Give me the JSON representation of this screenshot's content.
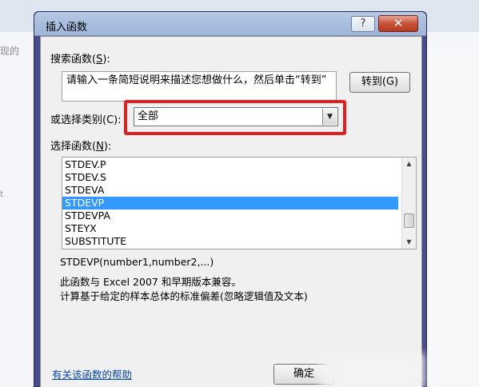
{
  "background": {
    "left_text": "现的",
    "side_text": "t"
  },
  "dialog": {
    "title": "插入函数",
    "help_button": "?",
    "close_button": "✕",
    "search_label": "搜索函数(",
    "search_label_key": "S",
    "search_label_end": "):",
    "search_text": "请输入一条简短说明来描述您想做什么，然后单击“转到”",
    "go_button": "转到(G)",
    "category_label": "或选择类别(C):",
    "category_value": "全部",
    "function_label": "选择函数(",
    "function_label_key": "N",
    "function_label_end": "):",
    "functions": [
      "STDEV.P",
      "STDEV.S",
      "STDEVA",
      "STDEVP",
      "STDEVPA",
      "STEYX",
      "SUBSTITUTE"
    ],
    "selected_function": "STDEVP",
    "signature": "STDEVP(number1,number2,...)",
    "description_line1": "此函数与 Excel 2007 和早期版本兼容。",
    "description_line2": "计算基于给定的样本总体的标准偏差(忽略逻辑值及文本)",
    "help_link": "有关该函数的帮助",
    "ok_button": "确定"
  }
}
